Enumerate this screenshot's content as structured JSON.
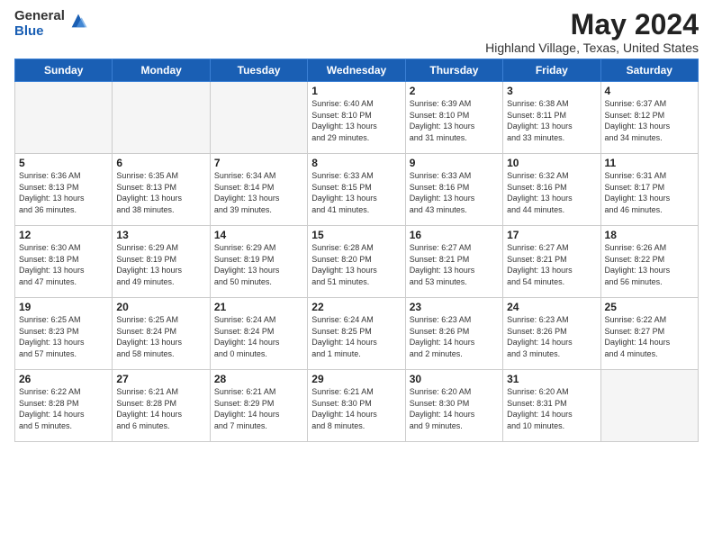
{
  "logo": {
    "general": "General",
    "blue": "Blue"
  },
  "title": "May 2024",
  "location": "Highland Village, Texas, United States",
  "weekdays": [
    "Sunday",
    "Monday",
    "Tuesday",
    "Wednesday",
    "Thursday",
    "Friday",
    "Saturday"
  ],
  "weeks": [
    [
      {
        "day": "",
        "info": ""
      },
      {
        "day": "",
        "info": ""
      },
      {
        "day": "",
        "info": ""
      },
      {
        "day": "1",
        "info": "Sunrise: 6:40 AM\nSunset: 8:10 PM\nDaylight: 13 hours\nand 29 minutes."
      },
      {
        "day": "2",
        "info": "Sunrise: 6:39 AM\nSunset: 8:10 PM\nDaylight: 13 hours\nand 31 minutes."
      },
      {
        "day": "3",
        "info": "Sunrise: 6:38 AM\nSunset: 8:11 PM\nDaylight: 13 hours\nand 33 minutes."
      },
      {
        "day": "4",
        "info": "Sunrise: 6:37 AM\nSunset: 8:12 PM\nDaylight: 13 hours\nand 34 minutes."
      }
    ],
    [
      {
        "day": "5",
        "info": "Sunrise: 6:36 AM\nSunset: 8:13 PM\nDaylight: 13 hours\nand 36 minutes."
      },
      {
        "day": "6",
        "info": "Sunrise: 6:35 AM\nSunset: 8:13 PM\nDaylight: 13 hours\nand 38 minutes."
      },
      {
        "day": "7",
        "info": "Sunrise: 6:34 AM\nSunset: 8:14 PM\nDaylight: 13 hours\nand 39 minutes."
      },
      {
        "day": "8",
        "info": "Sunrise: 6:33 AM\nSunset: 8:15 PM\nDaylight: 13 hours\nand 41 minutes."
      },
      {
        "day": "9",
        "info": "Sunrise: 6:33 AM\nSunset: 8:16 PM\nDaylight: 13 hours\nand 43 minutes."
      },
      {
        "day": "10",
        "info": "Sunrise: 6:32 AM\nSunset: 8:16 PM\nDaylight: 13 hours\nand 44 minutes."
      },
      {
        "day": "11",
        "info": "Sunrise: 6:31 AM\nSunset: 8:17 PM\nDaylight: 13 hours\nand 46 minutes."
      }
    ],
    [
      {
        "day": "12",
        "info": "Sunrise: 6:30 AM\nSunset: 8:18 PM\nDaylight: 13 hours\nand 47 minutes."
      },
      {
        "day": "13",
        "info": "Sunrise: 6:29 AM\nSunset: 8:19 PM\nDaylight: 13 hours\nand 49 minutes."
      },
      {
        "day": "14",
        "info": "Sunrise: 6:29 AM\nSunset: 8:19 PM\nDaylight: 13 hours\nand 50 minutes."
      },
      {
        "day": "15",
        "info": "Sunrise: 6:28 AM\nSunset: 8:20 PM\nDaylight: 13 hours\nand 51 minutes."
      },
      {
        "day": "16",
        "info": "Sunrise: 6:27 AM\nSunset: 8:21 PM\nDaylight: 13 hours\nand 53 minutes."
      },
      {
        "day": "17",
        "info": "Sunrise: 6:27 AM\nSunset: 8:21 PM\nDaylight: 13 hours\nand 54 minutes."
      },
      {
        "day": "18",
        "info": "Sunrise: 6:26 AM\nSunset: 8:22 PM\nDaylight: 13 hours\nand 56 minutes."
      }
    ],
    [
      {
        "day": "19",
        "info": "Sunrise: 6:25 AM\nSunset: 8:23 PM\nDaylight: 13 hours\nand 57 minutes."
      },
      {
        "day": "20",
        "info": "Sunrise: 6:25 AM\nSunset: 8:24 PM\nDaylight: 13 hours\nand 58 minutes."
      },
      {
        "day": "21",
        "info": "Sunrise: 6:24 AM\nSunset: 8:24 PM\nDaylight: 14 hours\nand 0 minutes."
      },
      {
        "day": "22",
        "info": "Sunrise: 6:24 AM\nSunset: 8:25 PM\nDaylight: 14 hours\nand 1 minute."
      },
      {
        "day": "23",
        "info": "Sunrise: 6:23 AM\nSunset: 8:26 PM\nDaylight: 14 hours\nand 2 minutes."
      },
      {
        "day": "24",
        "info": "Sunrise: 6:23 AM\nSunset: 8:26 PM\nDaylight: 14 hours\nand 3 minutes."
      },
      {
        "day": "25",
        "info": "Sunrise: 6:22 AM\nSunset: 8:27 PM\nDaylight: 14 hours\nand 4 minutes."
      }
    ],
    [
      {
        "day": "26",
        "info": "Sunrise: 6:22 AM\nSunset: 8:28 PM\nDaylight: 14 hours\nand 5 minutes."
      },
      {
        "day": "27",
        "info": "Sunrise: 6:21 AM\nSunset: 8:28 PM\nDaylight: 14 hours\nand 6 minutes."
      },
      {
        "day": "28",
        "info": "Sunrise: 6:21 AM\nSunset: 8:29 PM\nDaylight: 14 hours\nand 7 minutes."
      },
      {
        "day": "29",
        "info": "Sunrise: 6:21 AM\nSunset: 8:30 PM\nDaylight: 14 hours\nand 8 minutes."
      },
      {
        "day": "30",
        "info": "Sunrise: 6:20 AM\nSunset: 8:30 PM\nDaylight: 14 hours\nand 9 minutes."
      },
      {
        "day": "31",
        "info": "Sunrise: 6:20 AM\nSunset: 8:31 PM\nDaylight: 14 hours\nand 10 minutes."
      },
      {
        "day": "",
        "info": ""
      }
    ]
  ]
}
